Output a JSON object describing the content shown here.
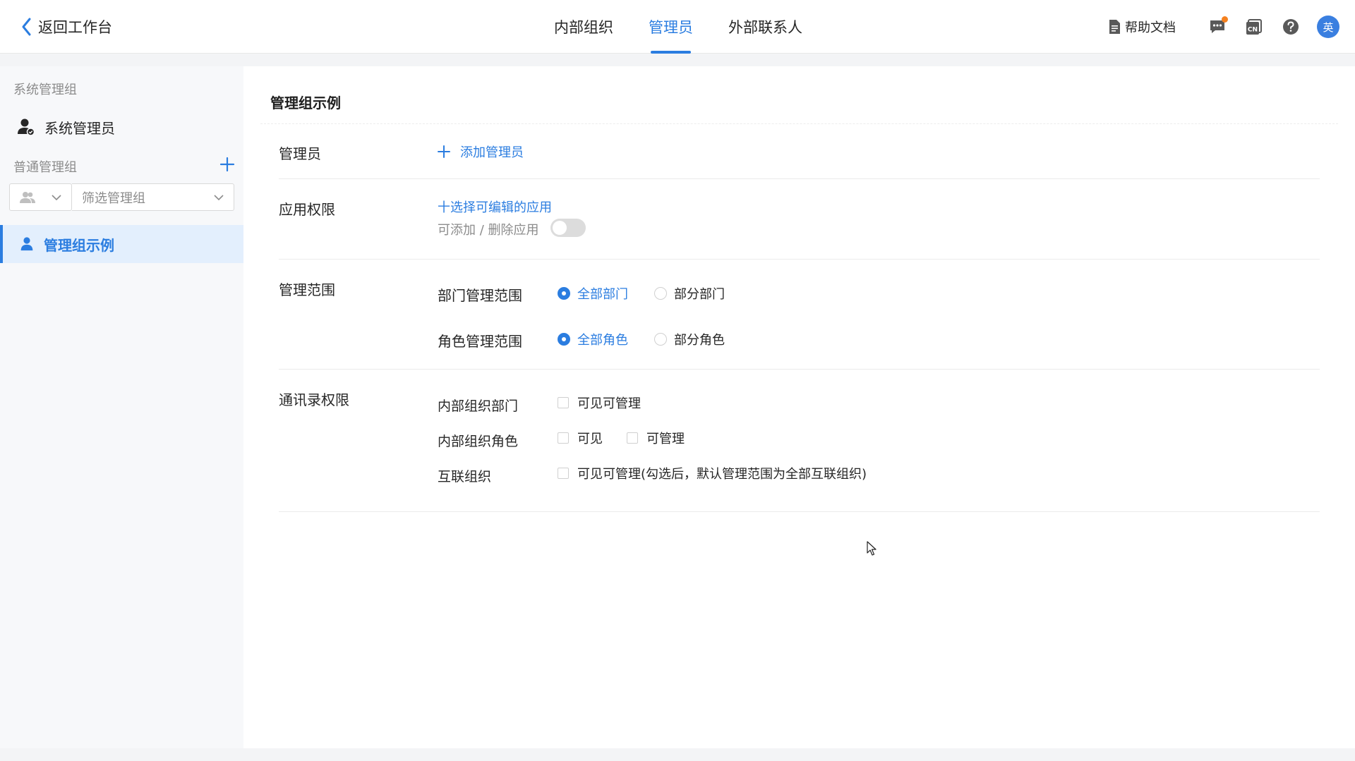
{
  "header": {
    "back_label": "返回工作台",
    "tabs": [
      {
        "label": "内部组织",
        "active": false
      },
      {
        "label": "管理员",
        "active": true
      },
      {
        "label": "外部联系人",
        "active": false
      }
    ],
    "help_label": "帮助文档",
    "avatar_text": "英"
  },
  "sidebar": {
    "system_group_title": "系统管理组",
    "system_admin_label": "系统管理员",
    "normal_group_title": "普通管理组",
    "filter_placeholder": "筛选管理组",
    "active_item_label": "管理组示例"
  },
  "main": {
    "title": "管理组示例",
    "admins": {
      "label": "管理员",
      "add_link": "添加管理员"
    },
    "app_perm": {
      "label": "应用权限",
      "select_link": "十选择可编辑的应用",
      "toggle_label": "可添加 / 删除应用",
      "toggle_on": false
    },
    "scope": {
      "label": "管理范围",
      "dept_label": "部门管理范围",
      "dept_all": "全部部门",
      "dept_part": "部分部门",
      "role_label": "角色管理范围",
      "role_all": "全部角色",
      "role_part": "部分角色"
    },
    "contacts": {
      "label": "通讯录权限",
      "org_dept_label": "内部组织部门",
      "org_dept_opt": "可见可管理",
      "org_role_label": "内部组织角色",
      "org_role_visible": "可见",
      "org_role_manage": "可管理",
      "interconnect_label": "互联组织",
      "interconnect_opt": "可见可管理(勾选后，默认管理范围为全部互联组织)"
    }
  },
  "colors": {
    "accent": "#2b7de0",
    "badge": "#f5811f"
  }
}
